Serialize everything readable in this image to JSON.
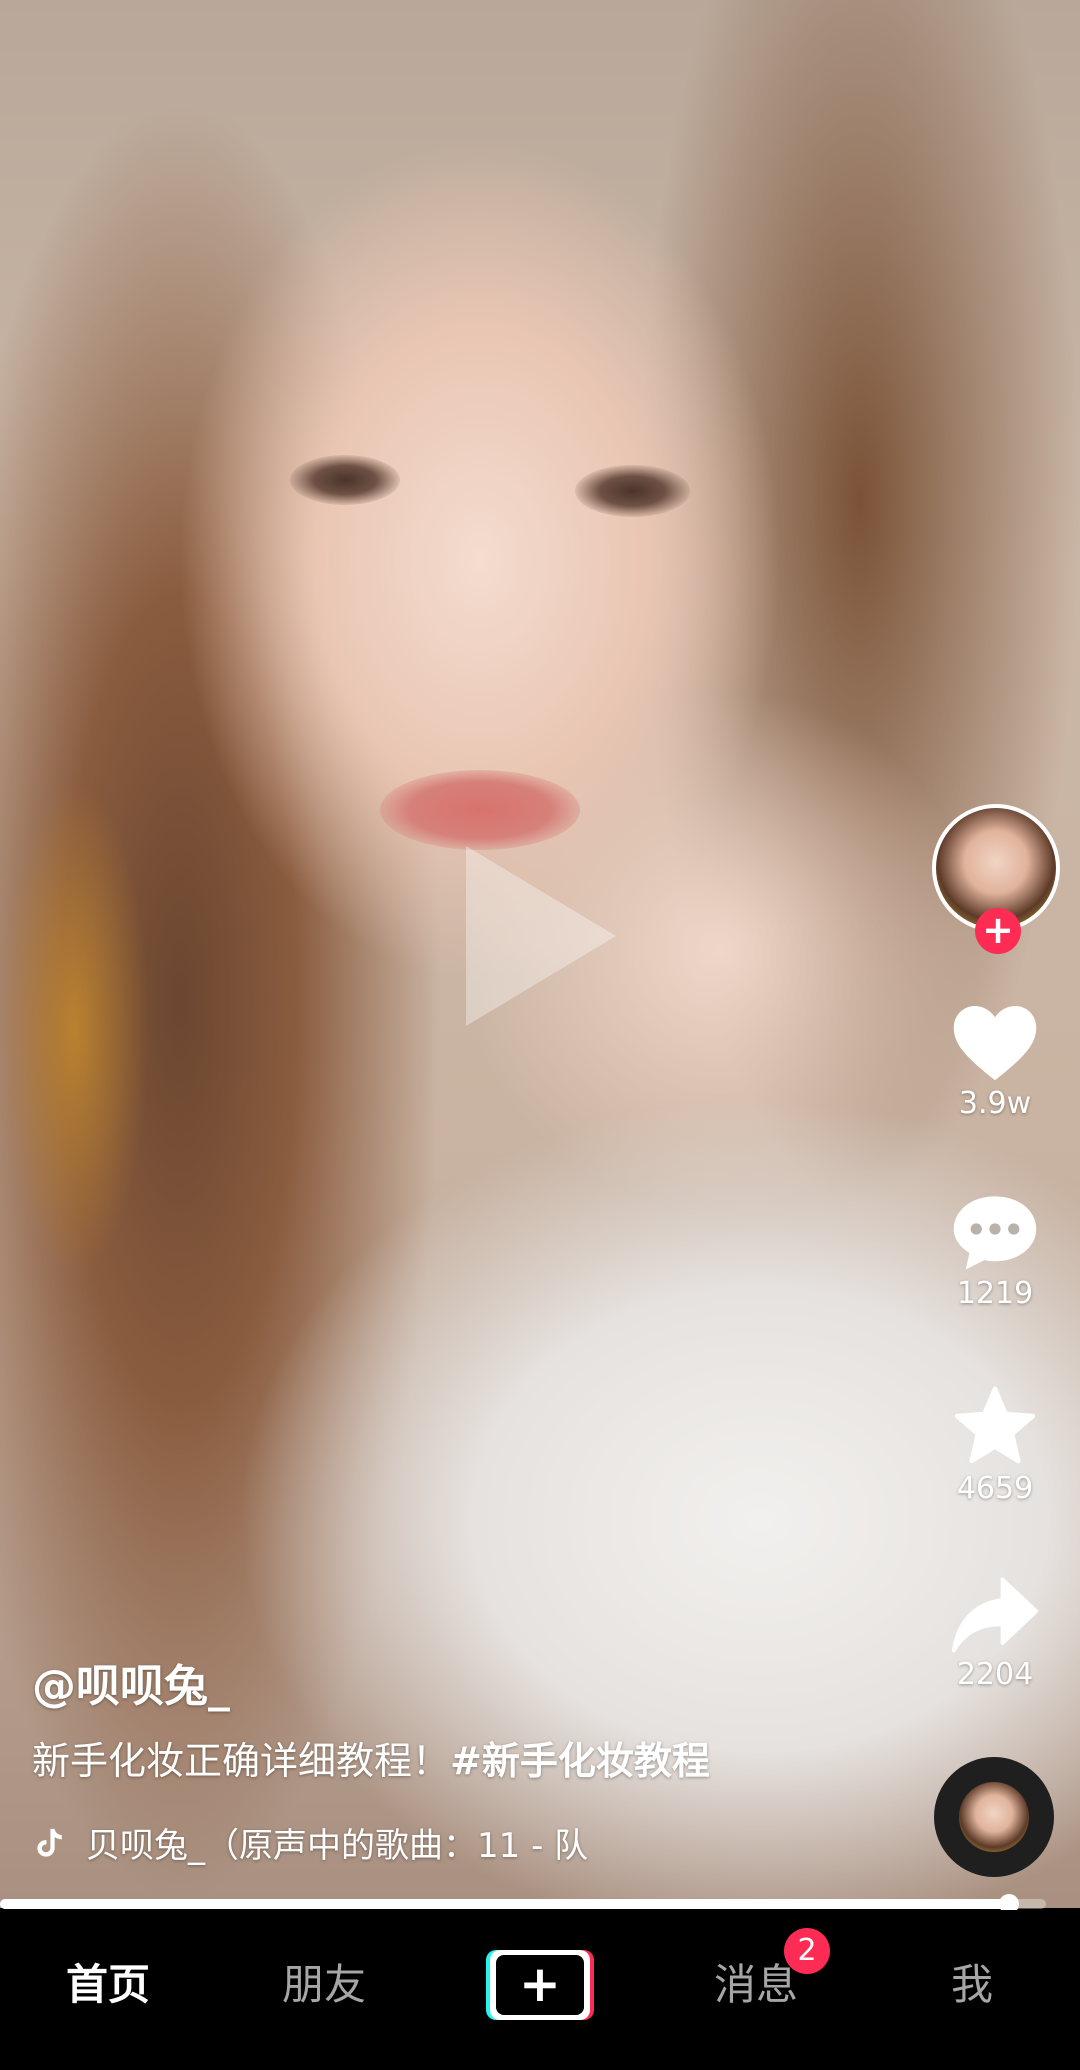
{
  "video": {
    "progress_fraction": 0.965
  },
  "creator": {
    "follow_label": "+"
  },
  "actions": {
    "like_count": "3.9w",
    "comment_count": "1219",
    "favorite_count": "4659",
    "share_count": "2204"
  },
  "caption": {
    "author": "@呗呗兔_",
    "description": "新手化妆正确详细教程！",
    "hashtag": "#新手化妆教程",
    "music": "贝呗兔_（原声中的歌曲：11 - 队"
  },
  "tabbar": {
    "home": "首页",
    "friends": "朋友",
    "create": "+",
    "messages": "消息",
    "messages_badge": "2",
    "me": "我"
  },
  "colors": {
    "accent": "#fe2c55",
    "cyan": "#25f4ee",
    "tab_inactive": "#a6a6a6"
  },
  "icons": [
    "play-icon",
    "heart-icon",
    "comment-icon",
    "star-icon",
    "share-icon",
    "music-note-icon"
  ]
}
